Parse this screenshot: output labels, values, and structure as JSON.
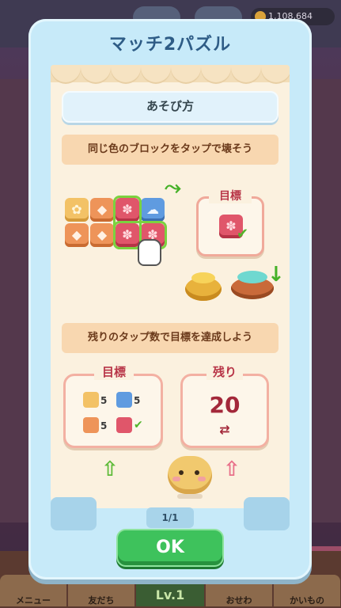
{
  "background": {
    "coins": "1,108,684",
    "tabs": [
      "メニュー",
      "友だち",
      "Lv.1",
      "おせわ",
      "かいもの"
    ]
  },
  "modal": {
    "title": "マッチ2パズル",
    "how_to_play": "あそび方",
    "step1": "同じ色のブロックをタップで壊そう",
    "step2": "残りのタップ数で目標を達成しよう",
    "target_label": "目標",
    "goal_label": "目標",
    "remaining_label": "残り",
    "remaining_count": "20",
    "remaining_icon": "⇄",
    "goals": [
      {
        "color": "yellow",
        "count": "5"
      },
      {
        "color": "blue",
        "count": "5"
      },
      {
        "color": "orange",
        "count": "5"
      },
      {
        "color": "red",
        "count": "✔"
      }
    ],
    "page_indicator": "1/1",
    "ok_label": "OK"
  },
  "colors": {
    "modal_bg": "#c7eaf9",
    "panel_bg": "#fbf1df",
    "ok_green": "#3ec25c",
    "title_blue": "#2e5c86"
  }
}
